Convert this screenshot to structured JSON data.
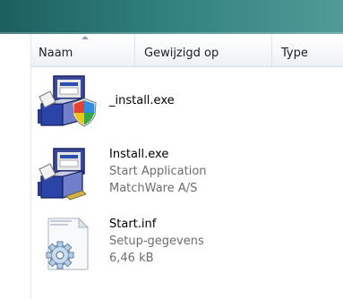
{
  "header": {
    "columns": [
      "Naam",
      "Gewijzigd op",
      "Type"
    ],
    "sorted_column": "Naam"
  },
  "files": [
    {
      "name": "_install.exe",
      "icon": "installer-shield-icon"
    },
    {
      "name": "Install.exe",
      "description": "Start Application",
      "company": "MatchWare A/S",
      "icon": "installer-icon"
    },
    {
      "name": "Start.inf",
      "type": "Setup-gegevens",
      "size": "6,46 kB",
      "icon": "settings-file-icon"
    }
  ],
  "colors": {
    "title_bar": "#2d7b7a",
    "secondary_text": "#6d6d6d"
  }
}
